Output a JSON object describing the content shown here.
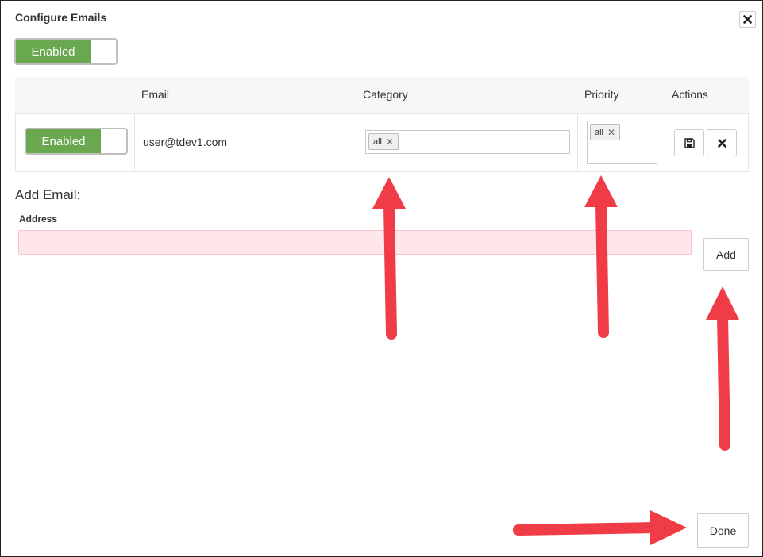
{
  "dialog": {
    "title": "Configure Emails",
    "close_icon": "close-icon"
  },
  "master_toggle": {
    "label": "Enabled",
    "state": "on"
  },
  "table": {
    "headers": {
      "email": "Email",
      "category": "Category",
      "priority": "Priority",
      "actions": "Actions"
    },
    "rows": [
      {
        "toggle_label": "Enabled",
        "email": "user@tdev1.com",
        "category_tags": [
          "all"
        ],
        "priority_tags": [
          "all"
        ]
      }
    ]
  },
  "add_email": {
    "heading": "Add Email:",
    "address_label": "Address",
    "address_value": "",
    "add_button": "Add"
  },
  "footer": {
    "done_button": "Done"
  },
  "colors": {
    "enabled_green": "#6aa84f",
    "invalid_input_bg": "#ffe6e8",
    "annotation_arrow": "#f03c46"
  }
}
